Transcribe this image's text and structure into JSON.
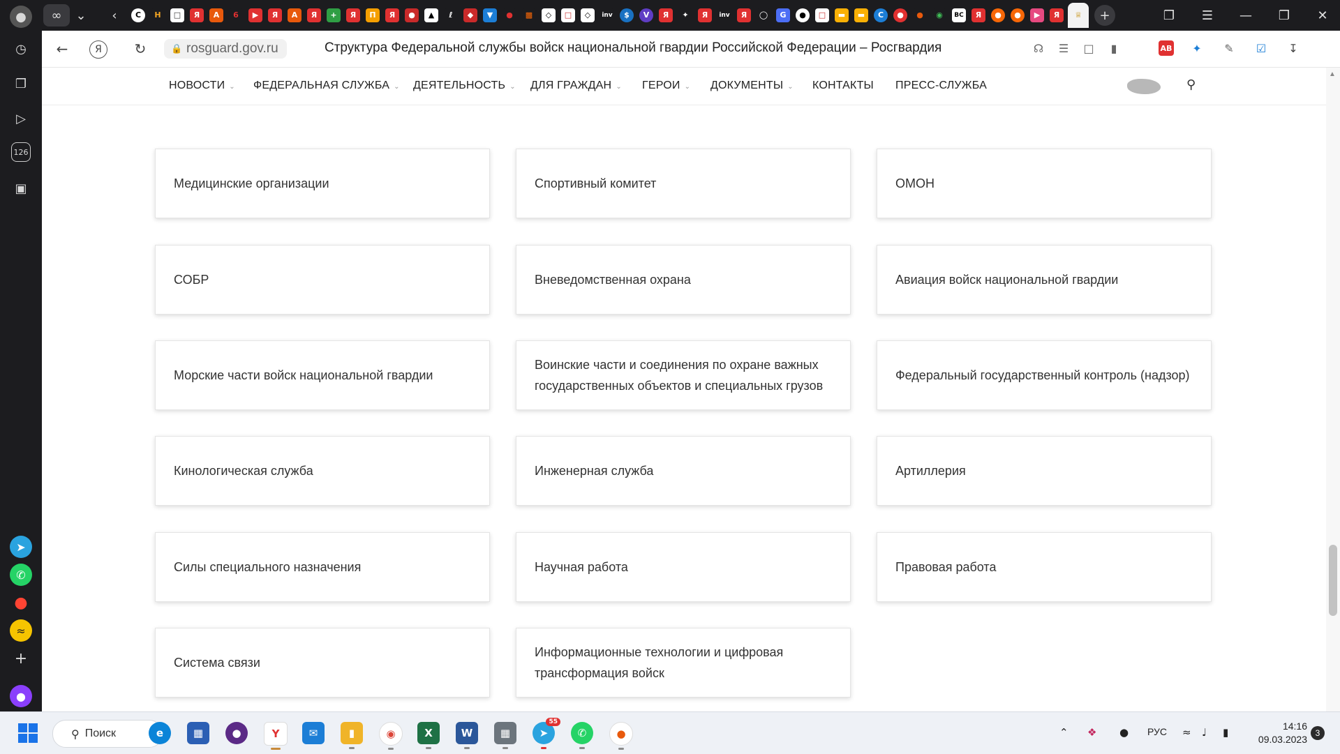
{
  "browser": {
    "url": "rosguard.gov.ru",
    "page_title": "Структура Федеральной службы войск национальной гвардии Российской Федерации – Росгвардия",
    "sidebar_badge": "126"
  },
  "site_nav": {
    "items": [
      {
        "label": "НОВОСТИ",
        "dropdown": true
      },
      {
        "label": "ФЕДЕРАЛЬНАЯ СЛУЖБА",
        "dropdown": true
      },
      {
        "label": "ДЕЯТЕЛЬНОСТЬ",
        "dropdown": true
      },
      {
        "label": "ДЛЯ ГРАЖДАН",
        "dropdown": true
      },
      {
        "label": "ГЕРОИ",
        "dropdown": true
      },
      {
        "label": "ДОКУМЕНТЫ",
        "dropdown": true
      },
      {
        "label": "КОНТАКТЫ",
        "dropdown": false
      },
      {
        "label": "ПРЕСС-СЛУЖБА",
        "dropdown": false
      }
    ]
  },
  "cards": [
    "Медицинские организации",
    "Спортивный комитет",
    "ОМОН",
    "СОБР",
    "Вневедомственная охрана",
    "Авиация войск национальной гвардии",
    "Морские части войск национальной гвардии",
    "Воинские части и соединения по охране важных государственных объектов и специальных грузов",
    "Федеральный государственный контроль (надзор)",
    "Кинологическая служба",
    "Инженерная служба",
    "Артиллерия",
    "Силы специального назначения",
    "Научная работа",
    "Правовая работа",
    "Система связи",
    "Информационные технологии и цифровая трансформация войск"
  ],
  "taskbar": {
    "search_label": "Поиск",
    "telegram_badge": "55",
    "language": "РУС",
    "time": "14:16",
    "date": "09.03.2023",
    "notifications": "3"
  },
  "colors": {
    "sidebar_bg": "#1c1c1f",
    "card_text": "#333333",
    "accent_blue": "#1a73e8"
  }
}
